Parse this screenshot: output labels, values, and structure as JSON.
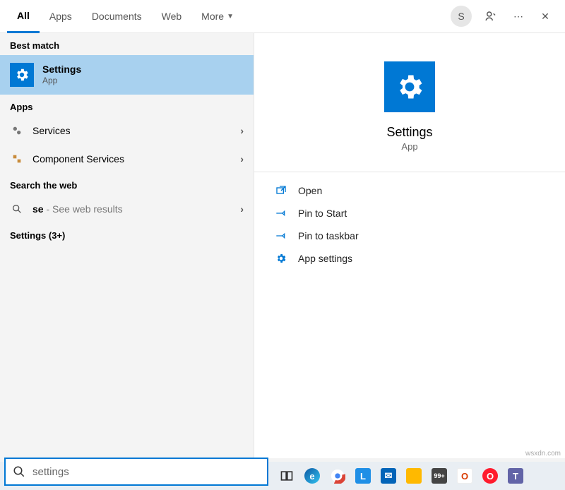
{
  "tabs": {
    "items": [
      {
        "label": "All",
        "active": true
      },
      {
        "label": "Apps",
        "active": false
      },
      {
        "label": "Documents",
        "active": false
      },
      {
        "label": "Web",
        "active": false
      },
      {
        "label": "More",
        "active": false,
        "caret": true
      }
    ],
    "avatar_initial": "S"
  },
  "left": {
    "best_match_header": "Best match",
    "best_match": {
      "name": "Settings",
      "sub": "App"
    },
    "apps_header": "Apps",
    "apps": [
      {
        "name": "Services",
        "icon": "gears-icon"
      },
      {
        "name": "Component Services",
        "icon": "component-icon"
      }
    ],
    "web_header": "Search the web",
    "web": {
      "query": "se",
      "suffix": " - See web results"
    },
    "more_header": "Settings (3+)"
  },
  "detail": {
    "title": "Settings",
    "sub": "App",
    "actions": [
      {
        "label": "Open",
        "icon": "open-icon"
      },
      {
        "label": "Pin to Start",
        "icon": "pin-icon"
      },
      {
        "label": "Pin to taskbar",
        "icon": "pin-icon"
      },
      {
        "label": "App settings",
        "icon": "gear-icon"
      }
    ]
  },
  "search": {
    "value": "settings"
  },
  "taskbar": {
    "items": [
      {
        "name": "task-view-icon",
        "bg": "",
        "glyph": "▭"
      },
      {
        "name": "edge-icon",
        "bg": "#33a1d8",
        "glyph": "e"
      },
      {
        "name": "chrome-icon",
        "bg": "#ffffff",
        "glyph": "◐"
      },
      {
        "name": "app-l-icon",
        "bg": "#1f8fe6",
        "glyph": "L"
      },
      {
        "name": "mail-icon",
        "bg": "#0364b8",
        "glyph": "✉"
      },
      {
        "name": "explorer-icon",
        "bg": "#ffb900",
        "glyph": "▮"
      },
      {
        "name": "badge-99",
        "bg": "#444444",
        "glyph": "99+"
      },
      {
        "name": "office-icon",
        "bg": "#ffffff",
        "glyph": "O"
      },
      {
        "name": "opera-icon",
        "bg": "#ff1b2d",
        "glyph": "O"
      },
      {
        "name": "teams-icon",
        "bg": "#6264a7",
        "glyph": "T"
      }
    ]
  },
  "watermark": "wsxdn.com"
}
